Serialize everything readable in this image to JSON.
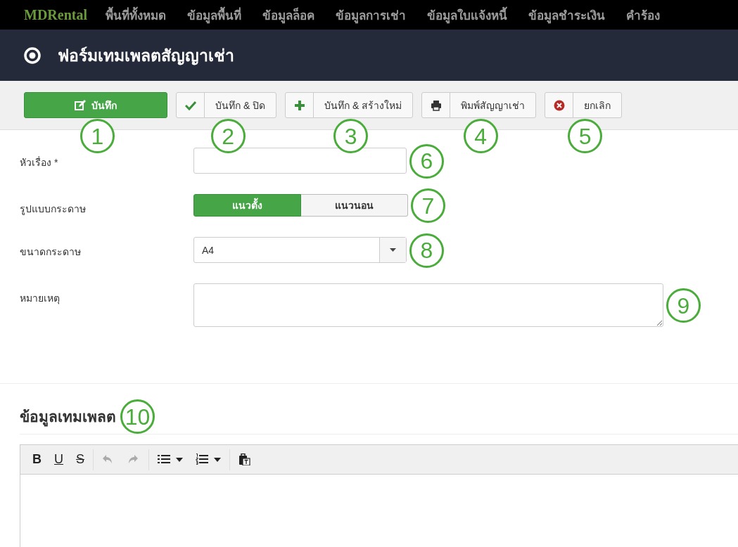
{
  "navbar": {
    "brand": "MDRental",
    "items": [
      {
        "label": "พื้นที่ทั้งหมด"
      },
      {
        "label": "ข้อมูลพื้นที่"
      },
      {
        "label": "ข้อมูลล็อค"
      },
      {
        "label": "ข้อมูลการเช่า"
      },
      {
        "label": "ข้อมูลใบแจ้งหนี้"
      },
      {
        "label": "ข้อมูลชำระเงิน"
      },
      {
        "label": "คำร้อง"
      }
    ]
  },
  "page_header": {
    "title": "ฟอร์มเทมเพลตสัญญาเช่า"
  },
  "toolbar": {
    "buttons": [
      {
        "label": "บันทึก",
        "kind": "primary",
        "callout": "1"
      },
      {
        "label": "บันทึก & ปิด",
        "kind": "default",
        "callout": "2"
      },
      {
        "label": "บันทึก & สร้างใหม่",
        "kind": "default",
        "callout": "3"
      },
      {
        "label": "พิมพ์สัญญาเช่า",
        "kind": "default",
        "callout": "4"
      },
      {
        "label": "ยกเลิก",
        "kind": "default",
        "callout": "5"
      }
    ]
  },
  "form": {
    "fields": [
      {
        "kind": "text",
        "label": "หัวเรื่อง *",
        "callout": "6"
      },
      {
        "kind": "toggle",
        "label": "รูปแบบกระดาษ",
        "options": [
          {
            "label": "แนวตั้ง",
            "selected": true
          },
          {
            "label": "แนวนอน",
            "selected": false
          }
        ],
        "callout": "7"
      },
      {
        "kind": "select",
        "label": "ขนาดกระดาษ",
        "value": "A4",
        "callout": "8"
      },
      {
        "kind": "textarea",
        "label": "หมายเหตุ",
        "callout": "9"
      }
    ]
  },
  "template_section": {
    "heading": "ข้อมูลเทมเพลต",
    "callout": "10",
    "editor_toolbar": [
      {
        "kind": "bold",
        "label": "B",
        "disabled": false
      },
      {
        "kind": "underline",
        "label": "U",
        "disabled": false
      },
      {
        "kind": "strike",
        "label": "S",
        "disabled": false
      },
      {
        "kind": "separator"
      },
      {
        "kind": "undo",
        "disabled": true
      },
      {
        "kind": "redo",
        "disabled": true
      },
      {
        "kind": "separator"
      },
      {
        "kind": "bullet-list",
        "disabled": false
      },
      {
        "kind": "number-list",
        "disabled": false
      },
      {
        "kind": "separator"
      },
      {
        "kind": "paste",
        "disabled": false
      }
    ]
  }
}
